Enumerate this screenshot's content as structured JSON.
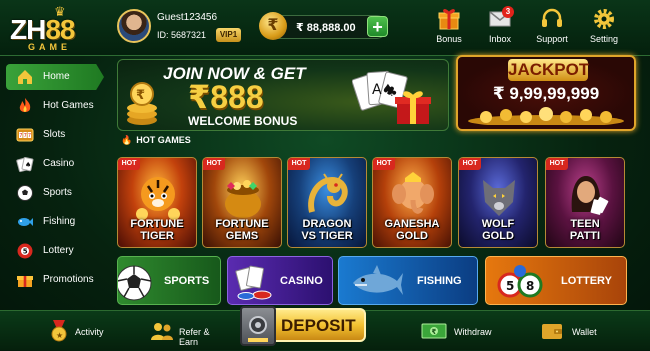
{
  "logo": {
    "main": "ZH",
    "accent": "88",
    "sub": "GAME"
  },
  "user": {
    "name": "Guest123456",
    "id_label": "ID: 5687321",
    "vip": "VIP1"
  },
  "wallet": {
    "currency_symbol": "₹",
    "balance": "₹ 88,888.00",
    "add_label": "+"
  },
  "header_nav": [
    {
      "label": "Bonus",
      "icon": "gift-icon"
    },
    {
      "label": "Inbox",
      "icon": "mail-icon",
      "badge": "3"
    },
    {
      "label": "Support",
      "icon": "headset-icon"
    },
    {
      "label": "Setting",
      "icon": "gear-icon"
    }
  ],
  "sidebar": {
    "items": [
      {
        "label": "Home",
        "icon": "home-icon",
        "active": true
      },
      {
        "label": "Hot Games",
        "icon": "fire-icon"
      },
      {
        "label": "Slots",
        "icon": "slot-machine-icon"
      },
      {
        "label": "Casino",
        "icon": "playing-cards-icon"
      },
      {
        "label": "Sports",
        "icon": "soccer-ball-icon"
      },
      {
        "label": "Fishing",
        "icon": "fish-icon"
      },
      {
        "label": "Lottery",
        "icon": "lottery-ball-icon"
      },
      {
        "label": "Promotions",
        "icon": "gift-box-icon"
      }
    ]
  },
  "welcome_banner": {
    "line1": "JOIN NOW & GET",
    "amount": "₹888",
    "line3": "WELCOME BONUS"
  },
  "jackpot": {
    "title": "JACKPOT",
    "value": "₹ 9,99,99,999"
  },
  "hot_games_section": {
    "title": "HOT GAMES"
  },
  "games": [
    {
      "badge": "HOT",
      "line1": "FORTUNE",
      "line2": "TIGER"
    },
    {
      "badge": "HOT",
      "line1": "FORTUNE",
      "line2": "GEMS"
    },
    {
      "badge": "HOT",
      "line1": "DRAGON",
      "line2": "VS TIGER"
    },
    {
      "badge": "HOT",
      "line1": "GANESHA",
      "line2": "GOLD"
    },
    {
      "badge": "HOT",
      "line1": "WOLF",
      "line2": "GOLD"
    },
    {
      "badge": "HOT",
      "line1": "TEEN",
      "line2": "PATTI"
    }
  ],
  "categories": [
    {
      "label": "SPORTS"
    },
    {
      "label": "CASINO"
    },
    {
      "label": "FISHING"
    },
    {
      "label": "LOTTERY"
    }
  ],
  "bottom_nav": {
    "activity": "Activity",
    "refer": "Refer & Earn",
    "deposit": "DEPOSIT",
    "withdraw": "Withdraw",
    "wallet": "Wallet"
  },
  "colors": {
    "accent_gold": "#f3c63b",
    "brand_green": "#1f7a22",
    "hot_red": "#d8281e"
  }
}
